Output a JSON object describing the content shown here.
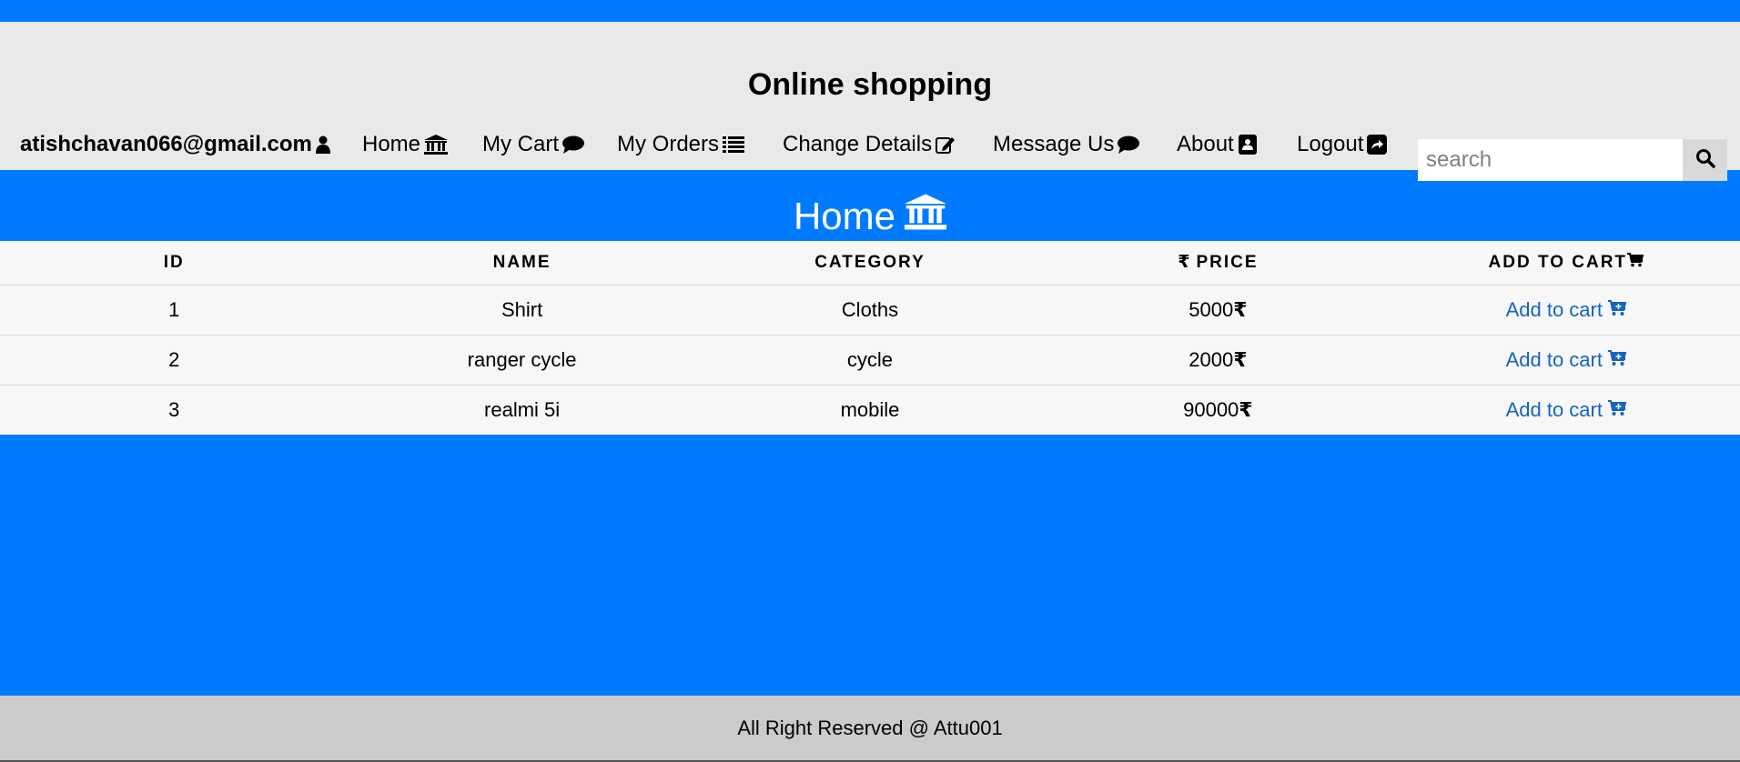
{
  "site": {
    "title": "Online shopping"
  },
  "nav": {
    "user_email": "atishchavan066@gmail.com",
    "items": [
      {
        "label": "Home",
        "icon": "bank-icon"
      },
      {
        "label": "My Cart",
        "icon": "comment-icon"
      },
      {
        "label": "My Orders",
        "icon": "list-icon"
      },
      {
        "label": "Change Details",
        "icon": "edit-icon"
      },
      {
        "label": "Message Us",
        "icon": "comment-icon"
      },
      {
        "label": "About",
        "icon": "address-book-icon"
      },
      {
        "label": "Logout",
        "icon": "share-square-icon"
      }
    ]
  },
  "search": {
    "placeholder": "search",
    "value": ""
  },
  "page": {
    "heading": "Home"
  },
  "table": {
    "headers": [
      "ID",
      "NAME",
      "CATEGORY",
      "PRICE",
      "ADD TO CART"
    ],
    "currency_symbol": "₹",
    "rows": [
      {
        "id": "1",
        "name": "Shirt",
        "category": "Cloths",
        "price": "5000",
        "action": "Add to cart"
      },
      {
        "id": "2",
        "name": "ranger cycle",
        "category": "cycle",
        "price": "2000",
        "action": "Add to cart"
      },
      {
        "id": "3",
        "name": "realmi 5i",
        "category": "mobile",
        "price": "90000",
        "action": "Add to cart"
      }
    ]
  },
  "footer": {
    "text": "All Right Reserved @ Attu001"
  },
  "colors": {
    "primary": "#007bff",
    "header_bg": "#e9e9e9",
    "footer_bg": "#cbcbcb",
    "link": "#1565c0"
  }
}
